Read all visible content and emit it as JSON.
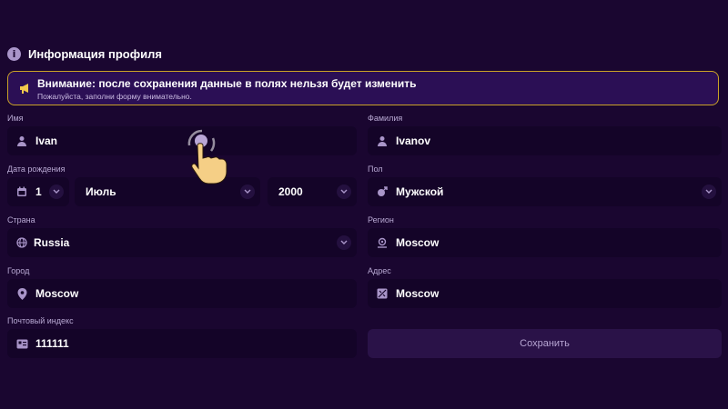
{
  "header": {
    "title": "Информация профиля"
  },
  "warning": {
    "title": "Внимание: после сохранения данные в полях нельзя будет изменить",
    "subtitle": "Пожалуйста, заполни форму внимательно."
  },
  "form": {
    "first_name": {
      "label": "Имя",
      "value": "Ivan"
    },
    "last_name": {
      "label": "Фамилия",
      "value": "Ivanov"
    },
    "birth_date": {
      "label": "Дата рождения",
      "day": "1",
      "month": "Июль",
      "year": "2000"
    },
    "gender": {
      "label": "Пол",
      "value": "Мужской"
    },
    "country": {
      "label": "Страна",
      "value": "Russia"
    },
    "region": {
      "label": "Регион",
      "value": "Moscow"
    },
    "city": {
      "label": "Город",
      "value": "Moscow"
    },
    "address": {
      "label": "Адрес",
      "value": "Moscow"
    },
    "postal_code": {
      "label": "Почтовый индекс",
      "value": "111111"
    }
  },
  "actions": {
    "save_label": "Сохранить"
  },
  "colors": {
    "background": "#1a0630",
    "field": "#140428",
    "warning_border": "#c9a227",
    "button": "#2a1248"
  },
  "icons": [
    "info-icon",
    "megaphone-icon",
    "user-icon",
    "calendar-icon",
    "chevron-down-icon",
    "gender-icon",
    "globe-icon",
    "region-pin-icon",
    "location-pin-icon",
    "map-icon",
    "id-card-icon",
    "tap-hand-icon"
  ]
}
